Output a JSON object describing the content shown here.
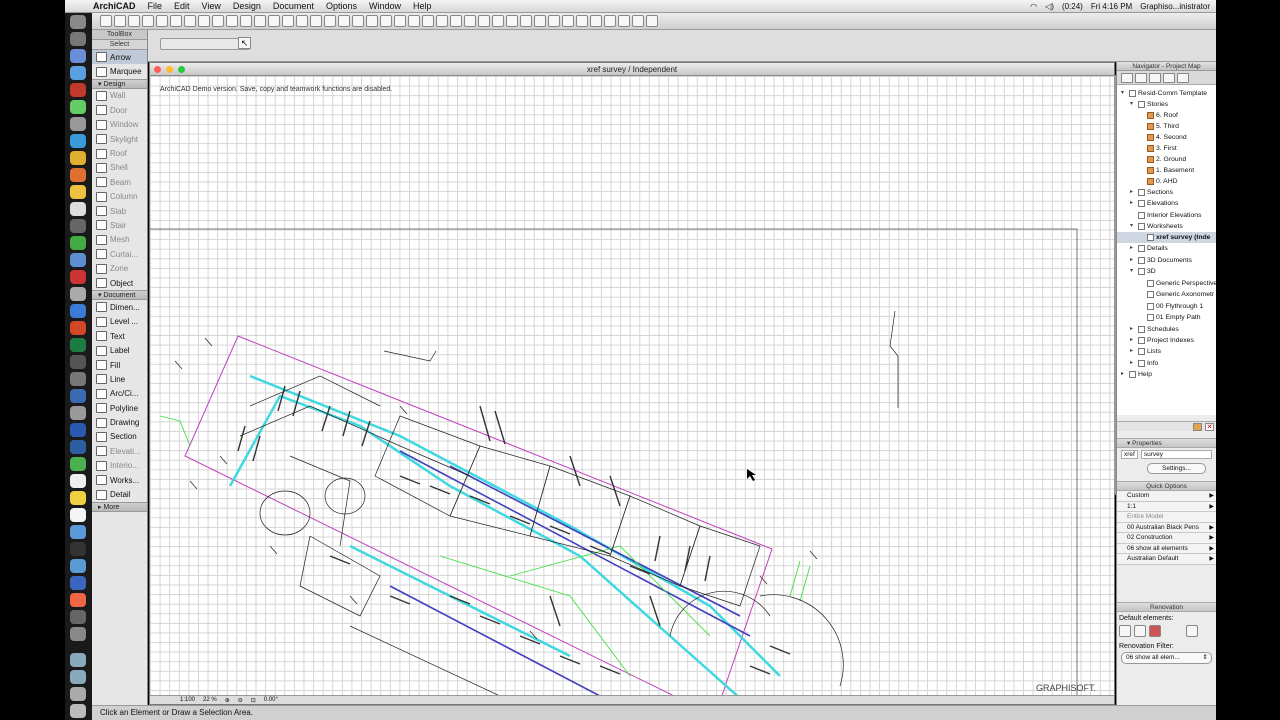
{
  "menubar": {
    "apple": "",
    "app_name": "ArchiCAD",
    "items": [
      "File",
      "Edit",
      "View",
      "Design",
      "Document",
      "Options",
      "Window",
      "Help"
    ],
    "battery": "(0:24)",
    "clock": "Fri 4:16 PM",
    "user": "Graphiso...inistrator"
  },
  "window": {
    "title": "xref survey / Independent",
    "demo_notice": "ArchiCAD Demo version. Save, copy and teamwork functions are disabled.",
    "brand": "GRAPHISOFT."
  },
  "toolbox": {
    "title": "ToolBox",
    "select_label": "Select",
    "select_tools": [
      {
        "label": "Arrow",
        "selected": true
      },
      {
        "label": "Marquee",
        "selected": false
      }
    ],
    "design_label": "Design",
    "design_tools": [
      {
        "label": "Wall",
        "dim": true
      },
      {
        "label": "Door",
        "dim": true
      },
      {
        "label": "Window",
        "dim": true
      },
      {
        "label": "Skylight",
        "dim": true
      },
      {
        "label": "Roof",
        "dim": true
      },
      {
        "label": "Shell",
        "dim": true
      },
      {
        "label": "Beam",
        "dim": true
      },
      {
        "label": "Column",
        "dim": true
      },
      {
        "label": "Slab",
        "dim": true
      },
      {
        "label": "Stair",
        "dim": true
      },
      {
        "label": "Mesh",
        "dim": true
      },
      {
        "label": "Curtai...",
        "dim": true
      },
      {
        "label": "Zone",
        "dim": true
      },
      {
        "label": "Object",
        "dim": false
      }
    ],
    "document_label": "Document",
    "document_tools": [
      {
        "label": "Dimen...",
        "dim": false
      },
      {
        "label": "Level ...",
        "dim": false
      },
      {
        "label": "Text",
        "dim": false
      },
      {
        "label": "Label",
        "dim": false
      },
      {
        "label": "Fill",
        "dim": false
      },
      {
        "label": "Line",
        "dim": false
      },
      {
        "label": "Arc/Ci...",
        "dim": false
      },
      {
        "label": "Polyline",
        "dim": false
      },
      {
        "label": "Drawing",
        "dim": false
      },
      {
        "label": "Section",
        "dim": false
      },
      {
        "label": "Elevati...",
        "dim": true
      },
      {
        "label": "Interio...",
        "dim": true
      },
      {
        "label": "Works...",
        "dim": false
      },
      {
        "label": "Detail",
        "dim": false
      }
    ],
    "more_label": "More"
  },
  "navigator": {
    "title": "Navigator - Project Map",
    "tree": [
      {
        "label": "Resid-Comm Template",
        "level": 0,
        "icon": "project-icon",
        "expanded": true
      },
      {
        "label": "Stories",
        "level": 1,
        "icon": "stories-icon",
        "expanded": true
      },
      {
        "label": "6. Roof",
        "level": 2,
        "icon": "story-icon"
      },
      {
        "label": "5. Third",
        "level": 2,
        "icon": "story-icon"
      },
      {
        "label": "4. Second",
        "level": 2,
        "icon": "story-icon"
      },
      {
        "label": "3. First",
        "level": 2,
        "icon": "story-icon"
      },
      {
        "label": "2. Ground",
        "level": 2,
        "icon": "story-icon"
      },
      {
        "label": "1. Basement",
        "level": 2,
        "icon": "story-icon"
      },
      {
        "label": "0. AHD",
        "level": 2,
        "icon": "story-icon"
      },
      {
        "label": "Sections",
        "level": 1,
        "icon": "section-icon",
        "expanded": false
      },
      {
        "label": "Elevations",
        "level": 1,
        "icon": "elevation-icon",
        "expanded": false
      },
      {
        "label": "Interior Elevations",
        "level": 1,
        "icon": "interior-elevation-icon"
      },
      {
        "label": "Worksheets",
        "level": 1,
        "icon": "worksheet-icon",
        "expanded": true
      },
      {
        "label": "xref survey (Inde",
        "level": 2,
        "icon": "worksheet-icon",
        "selected": true
      },
      {
        "label": "Details",
        "level": 1,
        "icon": "detail-icon",
        "expanded": false
      },
      {
        "label": "3D Documents",
        "level": 1,
        "icon": "document-3d-icon",
        "expanded": false
      },
      {
        "label": "3D",
        "level": 1,
        "icon": "cube-icon",
        "expanded": true
      },
      {
        "label": "Generic Perspective",
        "level": 2,
        "icon": "perspective-icon"
      },
      {
        "label": "Generic Axonometr",
        "level": 2,
        "icon": "axonometry-icon"
      },
      {
        "label": "00 Flythrough 1",
        "level": 2,
        "icon": "path-icon"
      },
      {
        "label": "01 Empty Path",
        "level": 2,
        "icon": "path-icon"
      },
      {
        "label": "Schedules",
        "level": 1,
        "icon": "schedule-icon",
        "expanded": false
      },
      {
        "label": "Project Indexes",
        "level": 1,
        "icon": "index-icon",
        "expanded": false
      },
      {
        "label": "Lists",
        "level": 1,
        "icon": "list-icon",
        "expanded": false
      },
      {
        "label": "Info",
        "level": 1,
        "icon": "info-icon",
        "expanded": false
      },
      {
        "label": "Help",
        "level": 0,
        "icon": "help-icon",
        "expanded": false
      }
    ]
  },
  "properties": {
    "title": "Properties",
    "id_label": "xref",
    "name_value": "survey",
    "settings_button": "Settings..."
  },
  "quick_options": {
    "title": "Quick Options",
    "options": [
      {
        "label": "Custom",
        "dim": false
      },
      {
        "label": "1:1",
        "dim": false
      },
      {
        "label": "Entire Model",
        "dim": true
      },
      {
        "label": "00 Australian Black Pens",
        "dim": false
      },
      {
        "label": "02 Construction",
        "dim": false
      },
      {
        "label": "06 show all elements",
        "dim": false
      },
      {
        "label": "Australian Default",
        "dim": false
      }
    ]
  },
  "renovation": {
    "title": "Renovation",
    "default_label": "Default elements:",
    "filter_label": "Renovation Filter:",
    "filter_value": "06 show all elem..."
  },
  "document_status": {
    "scale": "1:100",
    "zoom": "22 %",
    "angle": "0.00°"
  },
  "status_bar": {
    "message": "Click an Element or Draw a Selection Area."
  },
  "colors": {
    "site_boundary": "#c040c0",
    "cyan_lines": "#40d8e0",
    "green_lines": "#40e040",
    "blue_lines": "#4040c0",
    "selection": "#cfd6e2"
  }
}
